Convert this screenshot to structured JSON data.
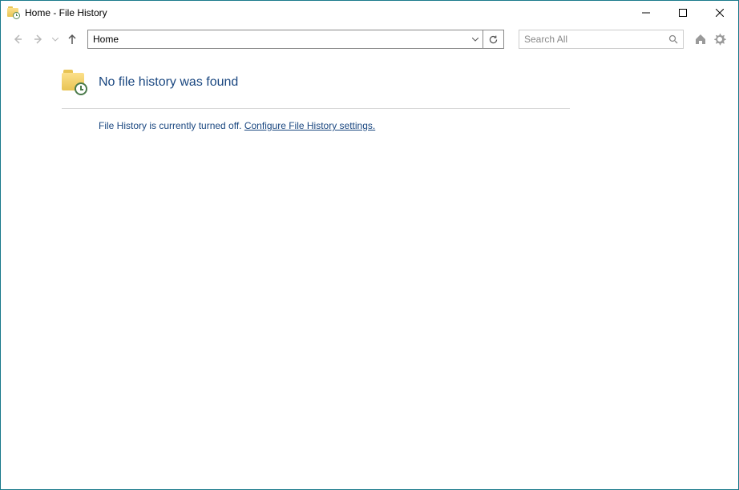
{
  "window": {
    "title": "Home - File History"
  },
  "toolbar": {
    "address_value": "Home",
    "search_placeholder": "Search All"
  },
  "main": {
    "heading": "No file history was found",
    "message_prefix": "File History is currently turned off. ",
    "configure_link": "Configure File History settings."
  }
}
